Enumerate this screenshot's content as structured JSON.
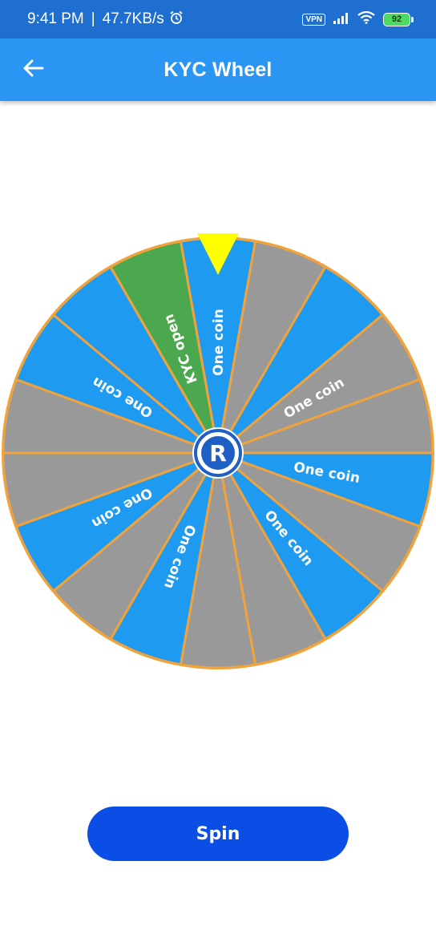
{
  "status_bar": {
    "time": "9:41 PM",
    "separator": "|",
    "network_speed": "47.7KB/s",
    "vpn_label": "VPN",
    "battery_level": "92"
  },
  "app_bar": {
    "title": "KYC Wheel"
  },
  "wheel": {
    "segments": [
      {
        "label": "One coin",
        "color": "#1e9bf0"
      },
      {
        "label": "",
        "color": "#999999"
      },
      {
        "label": "",
        "color": "#1e9bf0"
      },
      {
        "label": "One coin",
        "color": "#999999"
      },
      {
        "label": "",
        "color": "#999999"
      },
      {
        "label": "One coin",
        "color": "#1e9bf0"
      },
      {
        "label": "",
        "color": "#999999"
      },
      {
        "label": "One coin",
        "color": "#1e9bf0"
      },
      {
        "label": "",
        "color": "#999999"
      },
      {
        "label": "",
        "color": "#999999"
      },
      {
        "label": "One coin",
        "color": "#1e9bf0"
      },
      {
        "label": "",
        "color": "#999999"
      },
      {
        "label": "One coin",
        "color": "#1e9bf0"
      },
      {
        "label": "",
        "color": "#999999"
      },
      {
        "label": "",
        "color": "#999999"
      },
      {
        "label": "One coin",
        "color": "#1e9bf0"
      },
      {
        "label": "",
        "color": "#1e9bf0"
      },
      {
        "label": "KYC open",
        "color": "#4ba84e"
      }
    ],
    "pointer_color": "#ffff00",
    "border_color": "#f0a33c",
    "hub_letter": "R"
  },
  "spin_button": {
    "label": "Spin"
  }
}
